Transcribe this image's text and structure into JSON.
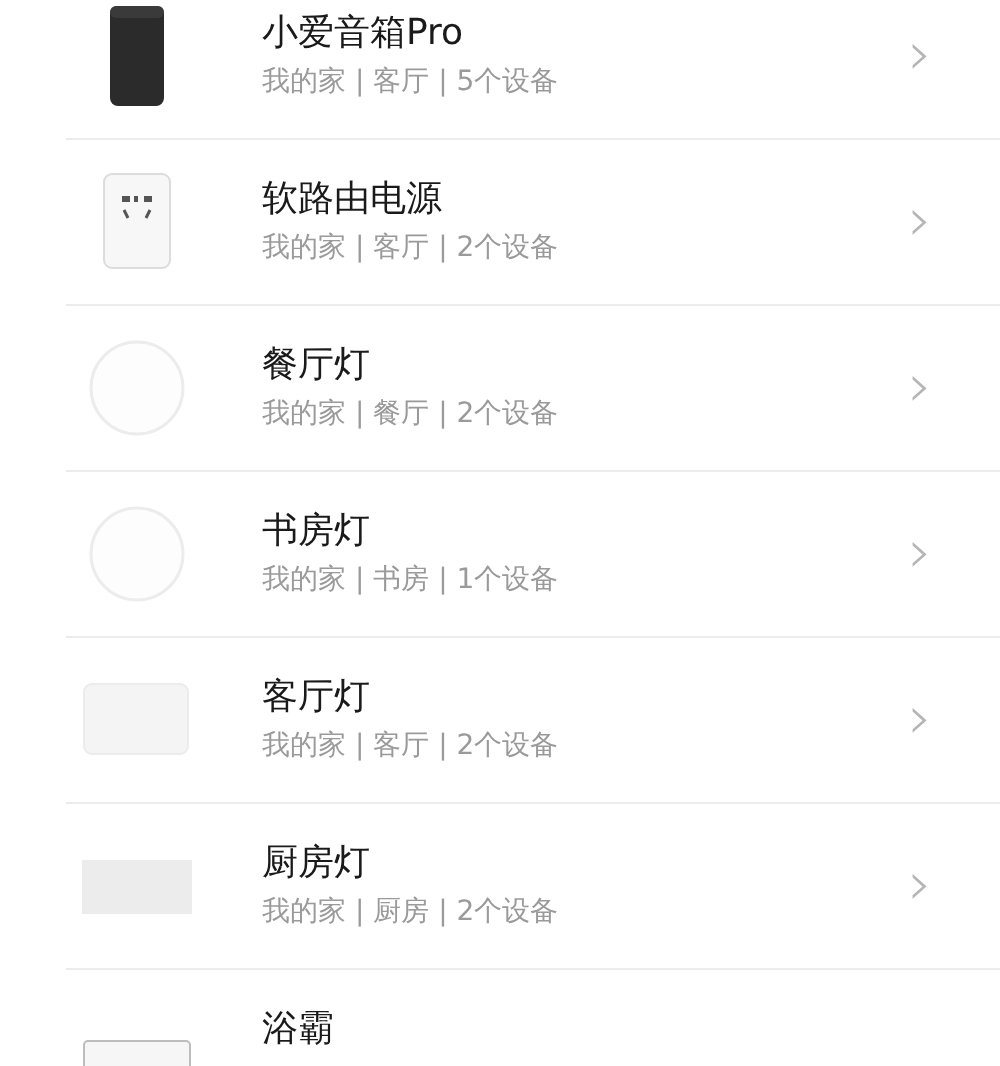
{
  "devices": [
    {
      "kind": "speaker",
      "name": "小爱音箱Pro",
      "detail": "我的家 | 客厅 | 5个设备",
      "chevron": "›"
    },
    {
      "kind": "plug",
      "name": "软路由电源",
      "detail": "我的家 | 客厅 | 2个设备",
      "chevron": "›"
    },
    {
      "kind": "round-light",
      "name": "餐厅灯",
      "detail": "我的家 | 餐厅 | 2个设备",
      "chevron": "›"
    },
    {
      "kind": "round-light",
      "name": "书房灯",
      "detail": "我的家 | 书房 | 1个设备",
      "chevron": "›"
    },
    {
      "kind": "rect-light",
      "name": "客厅灯",
      "detail": "我的家 | 客厅 | 2个设备",
      "chevron": "›"
    },
    {
      "kind": "panel-light",
      "name": "厨房灯",
      "detail": "我的家 | 厨房 | 2个设备",
      "chevron": "›"
    },
    {
      "kind": "heater",
      "name": "浴霸"
    }
  ]
}
